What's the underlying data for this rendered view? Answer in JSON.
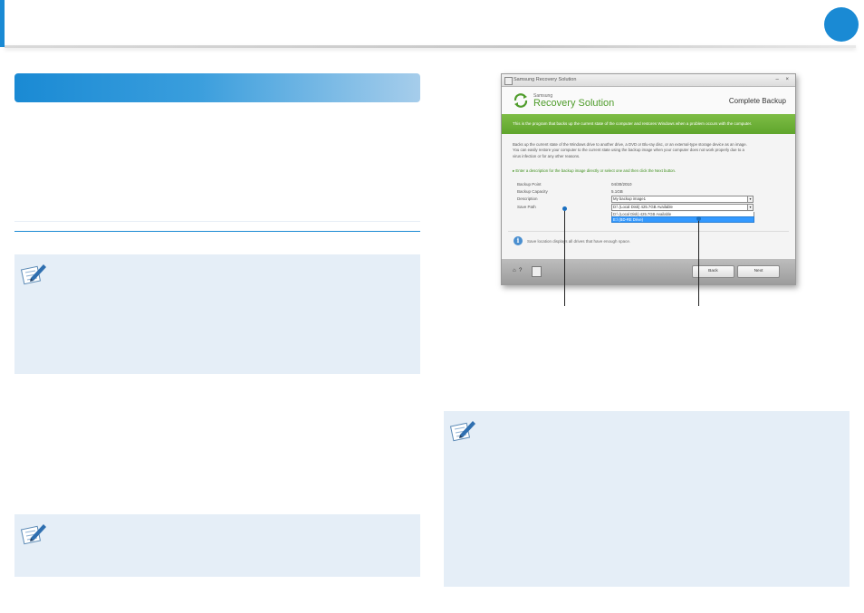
{
  "window": {
    "title": "Samsung Recovery Solution",
    "controls": "– ×",
    "brand_small": "Samsung",
    "brand_main": "Recovery Solution",
    "mode": "Complete Backup",
    "banner": "This is the program that backs up the current state of the computer and restores Windows when a problem occurs with the computer.",
    "description": [
      "Backs up the current state of the Windows drive to another drive, a DVD or Blu-ray disc, or an external-type storage device as an image.",
      "You can easily restore your computer to the current state using the backup image when your computer does not work properly due to a",
      "virus infection or for any other reasons."
    ],
    "instruction": "Enter a description for the backup image directly or select one and then click the Next button.",
    "fields": {
      "backup_point_label": "Backup Point",
      "backup_point_value": "04/30/2010",
      "backup_capacity_label": "Backup Capacity",
      "backup_capacity_value": "5.1GB",
      "description_label": "Description",
      "description_value": "My backup image1",
      "save_path_label": "Save Path",
      "save_path_value": "D:\\ (Local Disk) 425.7GB Available",
      "save_path_options": [
        "D:\\ (Local Disk) 425.7GB Available",
        "E:\\ (BD-RE Drive)"
      ]
    },
    "info_text": "Save location displays all drives that have enough space.",
    "footer": {
      "home_icon": "⌂",
      "help_icon": "?",
      "back_label": "Back",
      "next_label": "Next"
    }
  },
  "colors": {
    "accent_blue": "#1a8ad4",
    "brand_green": "#4f9c2b",
    "note_bg": "#e5eef7"
  }
}
